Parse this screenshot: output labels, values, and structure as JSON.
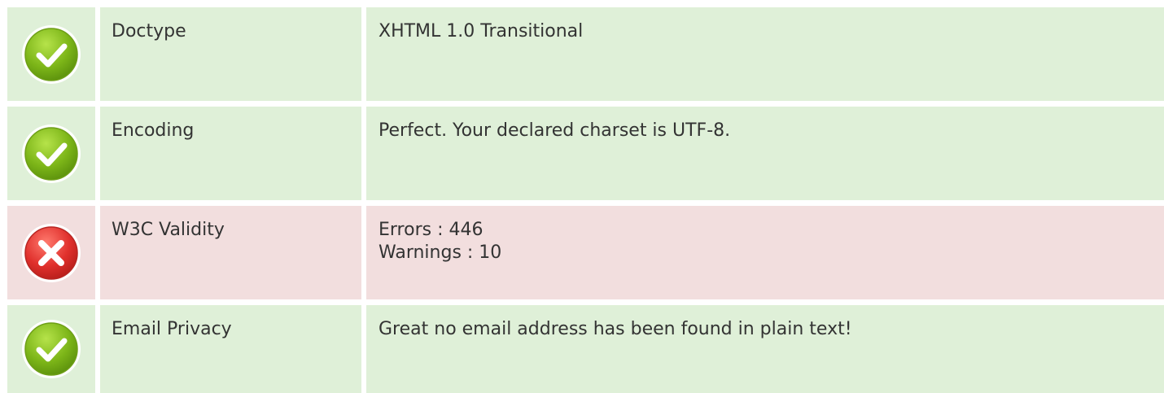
{
  "rows": [
    {
      "status": "ok",
      "icon": "check-circle-icon",
      "label": "Doctype",
      "values": [
        "XHTML 1.0 Transitional"
      ]
    },
    {
      "status": "ok",
      "icon": "check-circle-icon",
      "label": "Encoding",
      "values": [
        "Perfect. Your declared charset is UTF-8."
      ]
    },
    {
      "status": "error",
      "icon": "cross-circle-icon",
      "label": "W3C Validity",
      "values": [
        "Errors : 446",
        "Warnings : 10"
      ]
    },
    {
      "status": "ok",
      "icon": "check-circle-icon",
      "label": "Email Privacy",
      "values": [
        "Great no email address has been found in plain text!"
      ]
    }
  ],
  "colors": {
    "ok_background": "#dff0d8",
    "error_background": "#f2dede",
    "ok_icon": "#7cb518",
    "error_icon": "#e0302c"
  }
}
